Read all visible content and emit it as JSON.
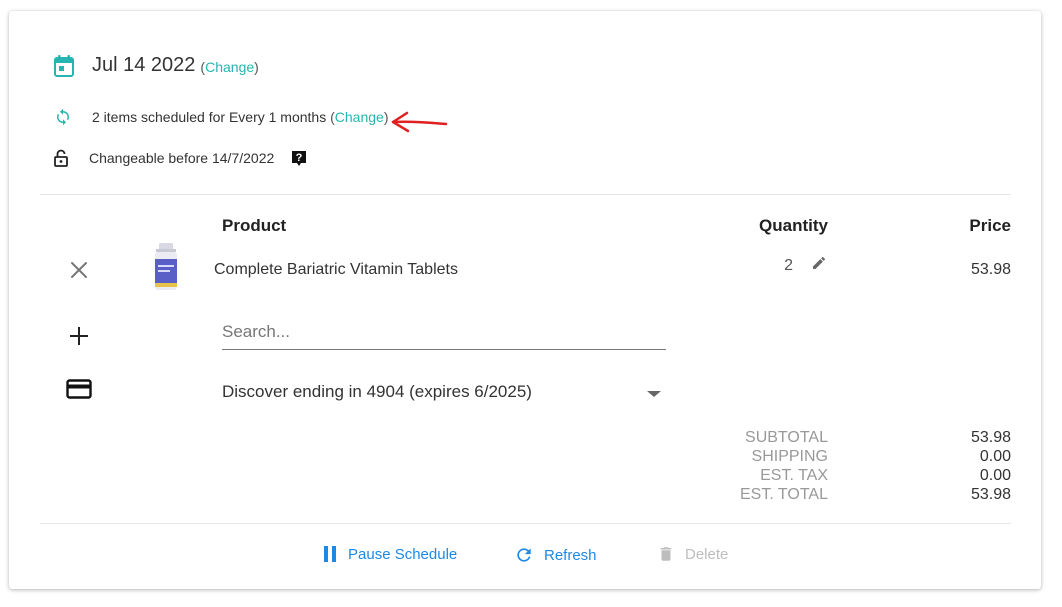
{
  "schedule": {
    "date": "Jul 14 2022",
    "date_change_open": "(",
    "date_change_link": "Change",
    "date_change_close": ")",
    "summary": "2 items scheduled for Every 1 months ",
    "summary_change_open": "(",
    "summary_change_link": "Change",
    "summary_change_close": ")",
    "lock_text": "Changeable before 14/7/2022"
  },
  "table": {
    "headers": {
      "product": "Product",
      "quantity": "Quantity",
      "price": "Price"
    },
    "rows": [
      {
        "name": "Complete Bariatric Vitamin Tablets",
        "quantity": "2",
        "price": "53.98"
      }
    ]
  },
  "search": {
    "placeholder": "Search..."
  },
  "payment": {
    "selected": "Discover ending in 4904 (expires 6/2025)"
  },
  "totals": {
    "labels": [
      "SUBTOTAL",
      "SHIPPING",
      "EST. TAX",
      "EST. TOTAL"
    ],
    "values": [
      "53.98",
      "0.00",
      "0.00",
      "53.98"
    ]
  },
  "actions": {
    "pause": "Pause Schedule",
    "refresh": "Refresh",
    "delete": "Delete"
  },
  "icons": {
    "date": "calendar-icon",
    "schedule": "sync-icon",
    "lock": "lock-open-icon",
    "help": "help-icon",
    "remove": "close-icon",
    "add": "plus-icon",
    "card": "credit-card-icon",
    "dropdown": "arrow-drop-down-icon",
    "edit": "pencil-icon",
    "pause": "pause-icon",
    "refresh": "refresh-icon",
    "delete": "trash-icon"
  },
  "colors": {
    "accent": "#26b5b0",
    "action": "#1e88e5",
    "disabled": "#bdbdbd",
    "annotation_arrow": "#e02020"
  }
}
